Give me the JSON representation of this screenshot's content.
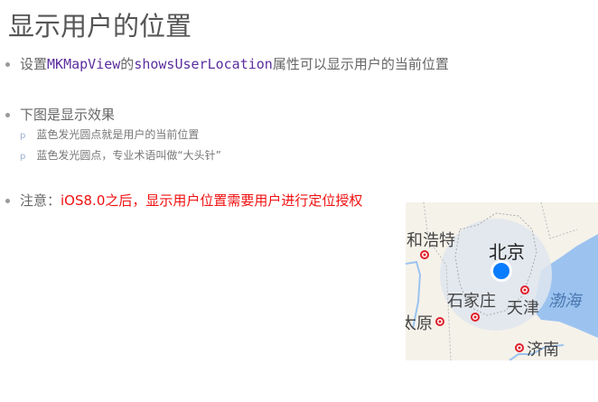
{
  "title": "显示用户的位置",
  "bullets": {
    "b1": {
      "prefix": "设置",
      "class_name": "MKMapView",
      "mid": "的",
      "property": "showsUserLocation",
      "suffix": "属性可以显示用户的当前位置"
    },
    "b2": {
      "text": "下图是显示效果",
      "subs": [
        "蓝色发光圆点就是用户的当前位置",
        "蓝色发光圆点，专业术语叫做“大头针”"
      ],
      "marker": "p"
    },
    "b3": {
      "label": "注意：",
      "warning": "iOS8.0之后，显示用户位置需要用户进行定位授权"
    }
  },
  "map": {
    "labels": {
      "hohhot": "和浩特",
      "beijing": "北京",
      "shijiazhuang": "石家庄",
      "tianjin": "天津",
      "bohai": "渤海",
      "taiyuan": "太原",
      "jinan": "济南"
    },
    "colors": {
      "user_dot": "#0a7cff",
      "sea": "#9cc3f0",
      "land": "#f5f2ea",
      "halo": "#dfe6ee",
      "city": "#e0202a"
    }
  }
}
